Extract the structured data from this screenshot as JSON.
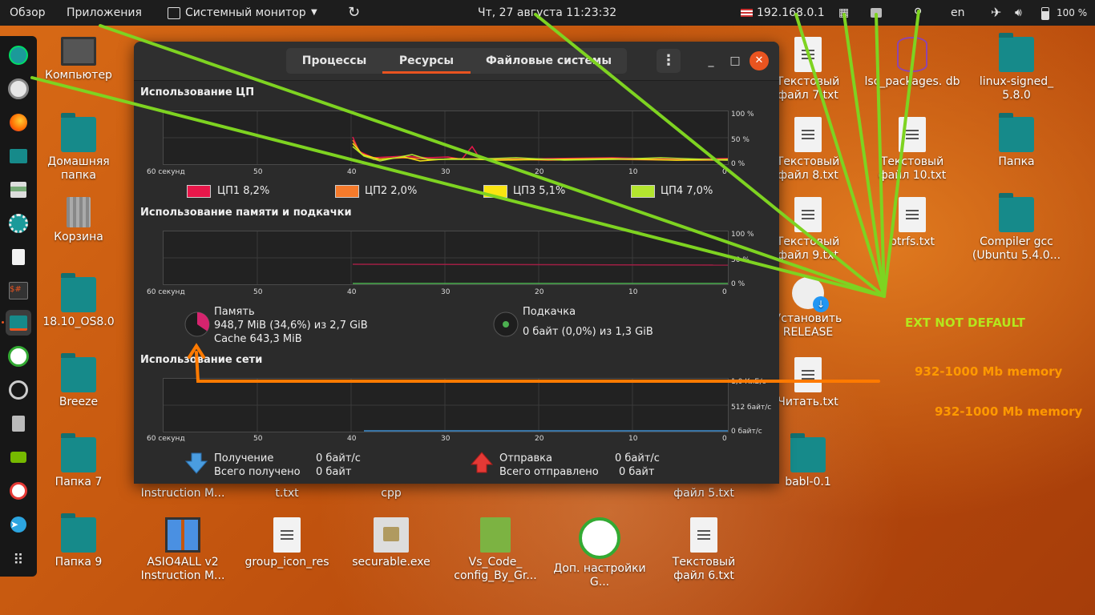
{
  "topbar": {
    "activities": "Обзор",
    "applications": "Приложения",
    "app_menu": "Системный монитор",
    "clock": "Чт, 27 августа  11:23:32",
    "ip": "192.168.0.1",
    "lang": "en",
    "battery": "100 %"
  },
  "desktop": {
    "icons": [
      {
        "label": "Компьютер"
      },
      {
        "label": "Домашняя папка"
      },
      {
        "label": "Корзина"
      },
      {
        "label": "18.10_OS8.0"
      },
      {
        "label": "Breeze"
      },
      {
        "label": "Папка 7"
      },
      {
        "label": "Папка 9"
      },
      {
        "label": "ASIO4ALL v2 Instruction M..."
      },
      {
        "label": "group_icon_res"
      },
      {
        "label": "securable.exe"
      },
      {
        "label": "Vs_Code_ config_By_Gr..."
      },
      {
        "label": "Доп. настройки G..."
      },
      {
        "label": "Текстовый файл 6.txt"
      },
      {
        "label": "babl-0.1"
      },
      {
        "label": "Текстовый файл 7.txt"
      },
      {
        "label": "Текстовый файл 8.txt"
      },
      {
        "label": "Текстовый файл 9.txt"
      },
      {
        "label": "Установить RELEASE"
      },
      {
        "label": "Читать.txt"
      },
      {
        "label": "lsc_packages. db"
      },
      {
        "label": "Текстовый файл 10.txt"
      },
      {
        "label": "btrfs.txt"
      },
      {
        "label": "linux-signed_ 5.8.0"
      },
      {
        "label": "Папка"
      },
      {
        "label": "Compiler gcc (Ubuntu 5.4.0..."
      },
      {
        "label": "ASIO4ALL v2 Instruction M..."
      },
      {
        "label": "t.txt"
      },
      {
        "label": "cpp"
      },
      {
        "label": "файл 5.txt"
      }
    ]
  },
  "window": {
    "tabs": [
      "Процессы",
      "Ресурсы",
      "Файловые системы"
    ],
    "selected_tab": "Ресурсы",
    "cpu": {
      "title": "Использование ЦП",
      "y_ticks": [
        "100 %",
        "50 %",
        "0 %"
      ],
      "x_ticks": [
        "60 секунд",
        "50",
        "40",
        "30",
        "20",
        "10",
        "0"
      ],
      "legend": [
        {
          "name": "ЦП1",
          "value": "8,2%",
          "color": "#e8174a"
        },
        {
          "name": "ЦП2",
          "value": "2,0%",
          "color": "#f57a2b"
        },
        {
          "name": "ЦП3",
          "value": "5,1%",
          "color": "#f9e411"
        },
        {
          "name": "ЦП4",
          "value": "7,0%",
          "color": "#b3e52f"
        }
      ]
    },
    "memory": {
      "title": "Использование памяти и подкачки",
      "y_ticks": [
        "100 %",
        "50 %",
        "0 %"
      ],
      "x_ticks": [
        "60 секунд",
        "50",
        "40",
        "30",
        "20",
        "10",
        "0"
      ],
      "mem_label": "Память",
      "mem_value": "948,7 MiB (34,6%) из 2,7 GiB",
      "cache_value": "Cache 643,3 MiB",
      "mem_fraction": 0.346,
      "swap_label": "Подкачка",
      "swap_value": "0 байт (0,0%) из 1,3 GiB"
    },
    "network": {
      "title": "Использование сети",
      "y_ticks": [
        "1,0 КиБ/с",
        "512 байт/с",
        "0 байт/с"
      ],
      "x_ticks": [
        "60 секунд",
        "50",
        "40",
        "30",
        "20",
        "10",
        "0"
      ],
      "recv_label": "Получение",
      "recv_rate": "0 байт/с",
      "recv_total_label": "Всего получено",
      "recv_total": "0 байт",
      "send_label": "Отправка",
      "send_rate": "0 байт/с",
      "send_total_label": "Всего отправлено",
      "send_total": "0 байт"
    }
  },
  "annotations": {
    "ext": "EXT NOT DEFAULT",
    "mem1": "932-1000 Mb memory",
    "mem2": "932-1000 Mb memory",
    "ext_color": "#b5e61d",
    "mem_color": "#ff9900"
  }
}
